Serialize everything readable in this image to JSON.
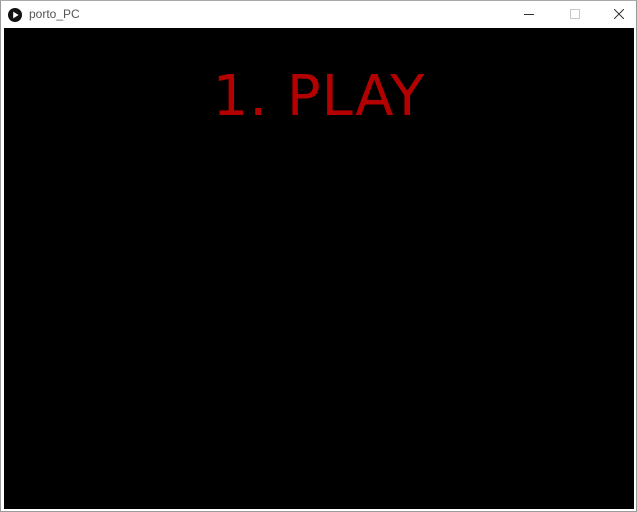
{
  "window": {
    "title": "porto_PC",
    "icon": "processing-play-icon"
  },
  "controls": {
    "minimize_icon": "minimize-icon",
    "maximize_icon": "maximize-icon",
    "close_icon": "close-icon"
  },
  "canvas": {
    "background_color": "#000000",
    "menu": {
      "option_label": "1. PLAY",
      "option_color": "#b30000"
    }
  }
}
